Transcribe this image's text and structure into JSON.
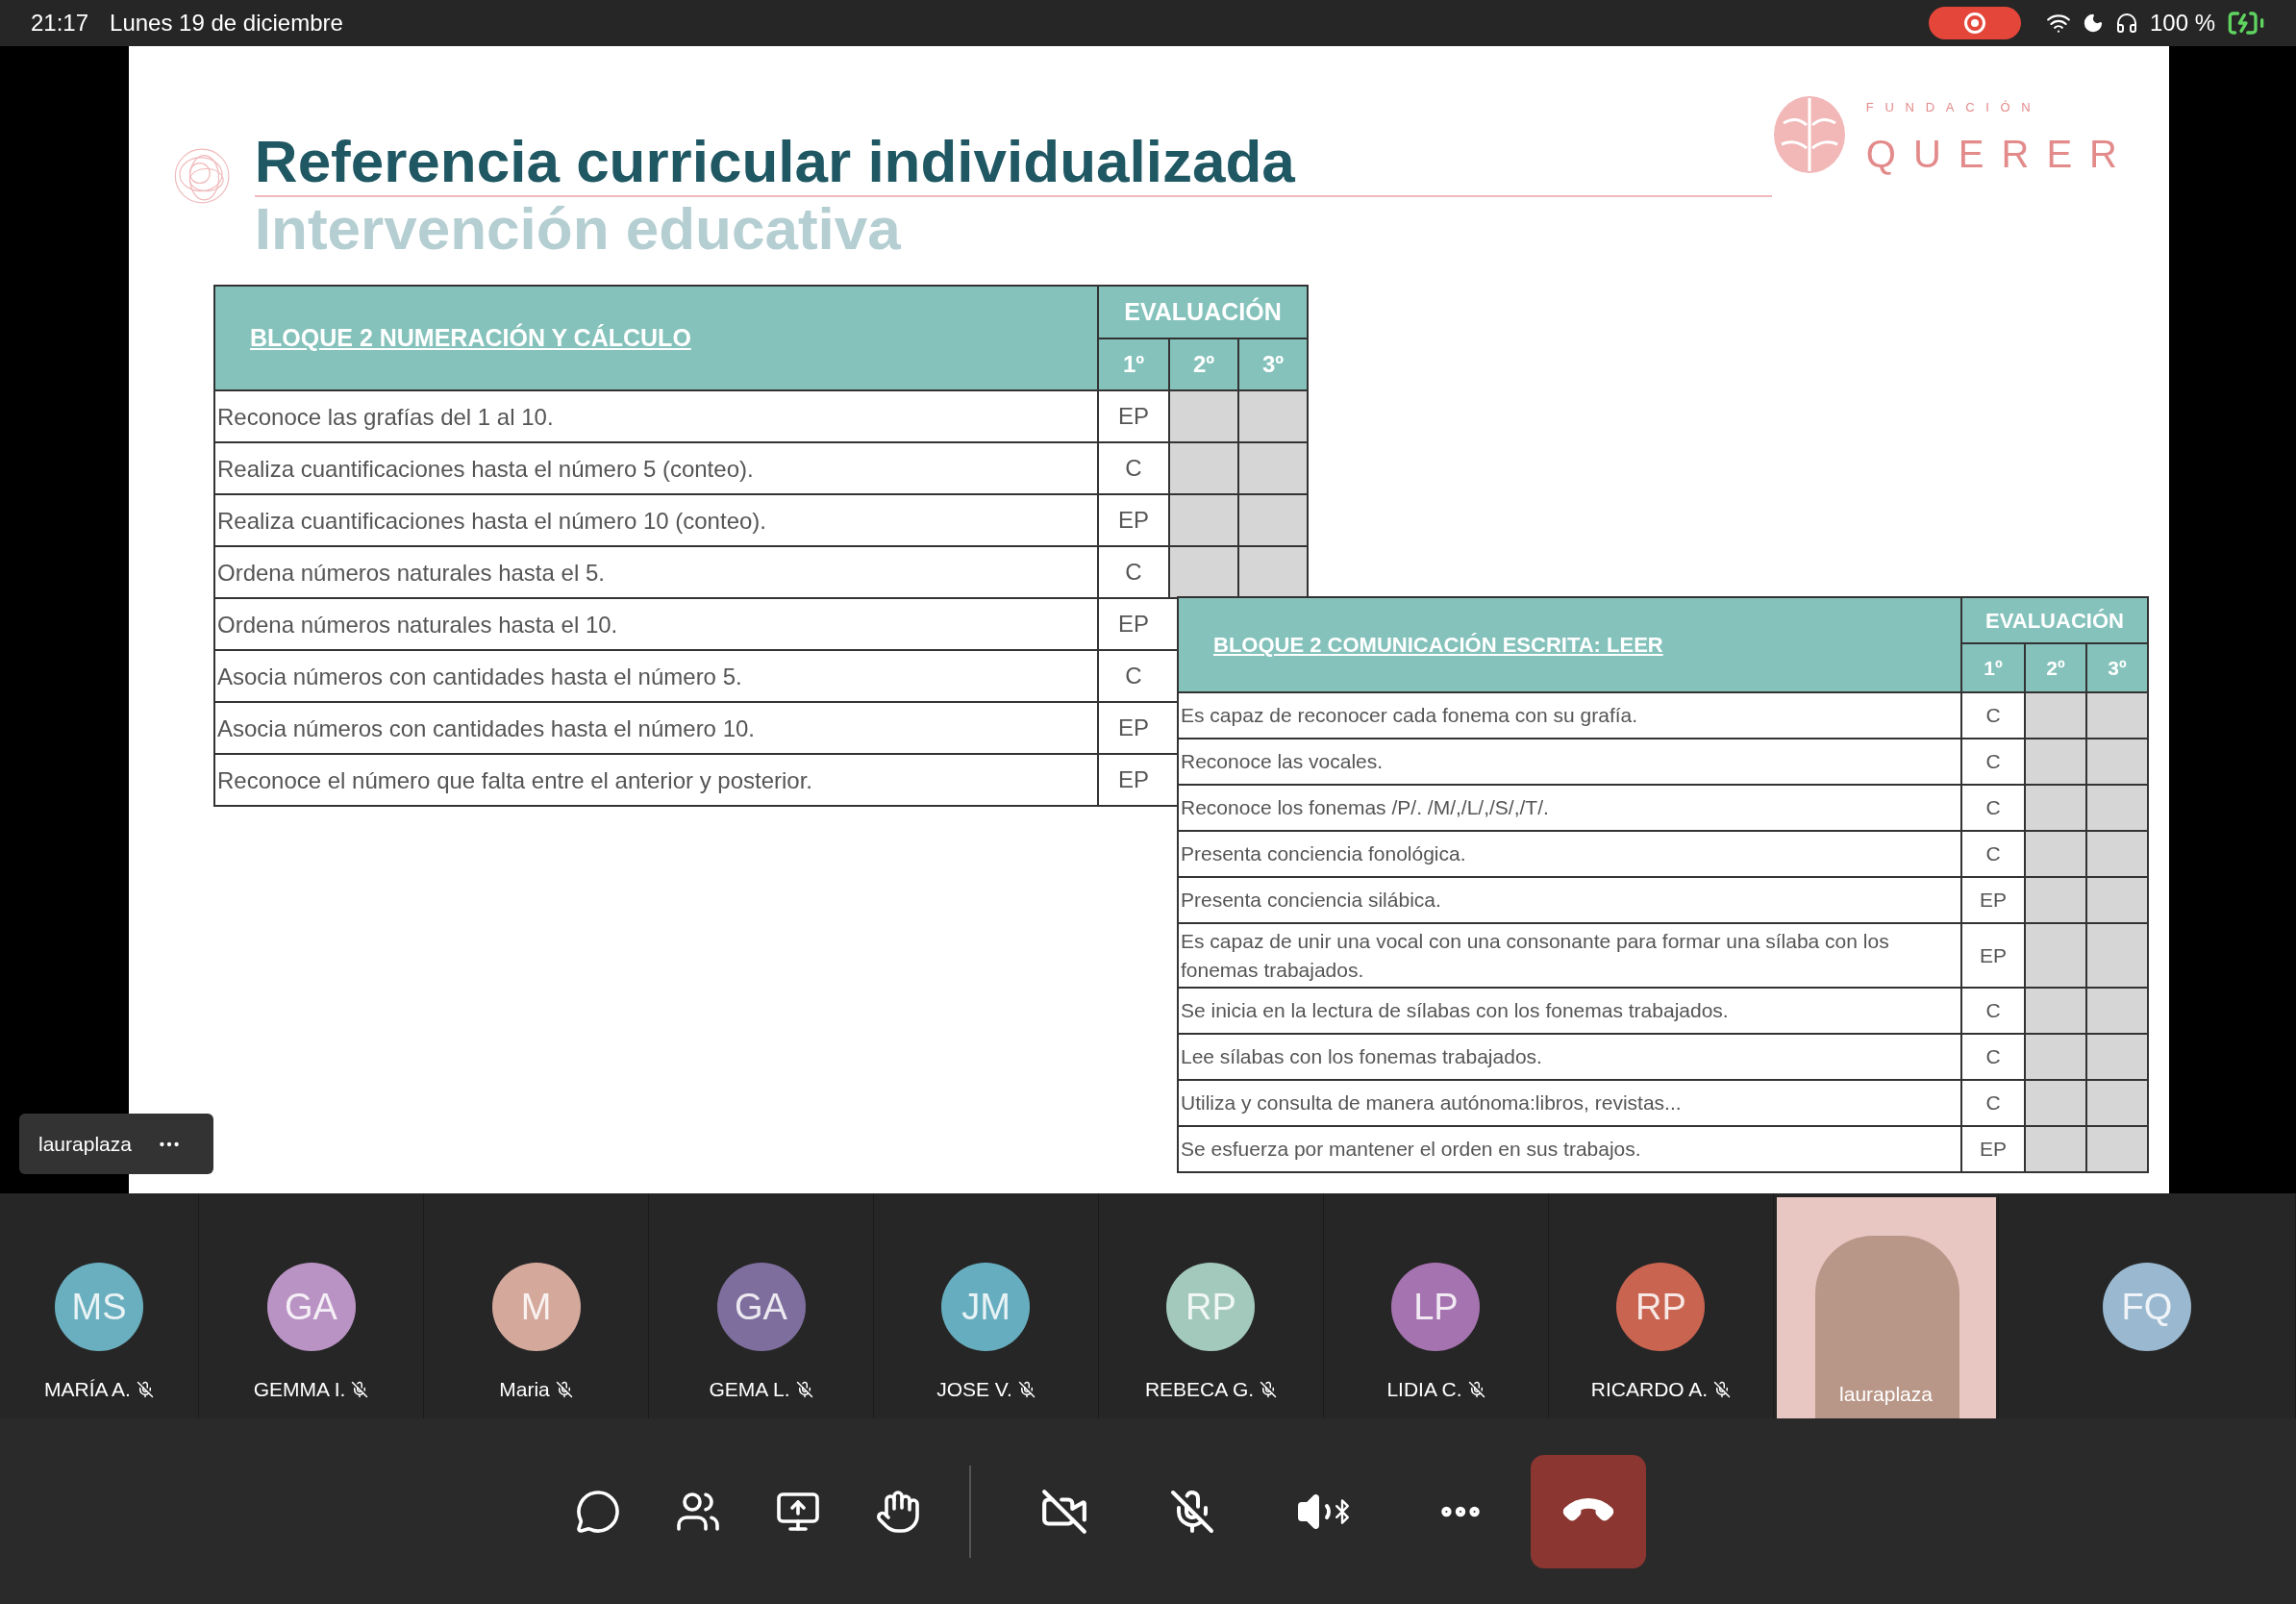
{
  "status_bar": {
    "time": "21:17",
    "date": "Lunes 19 de diciembre",
    "battery": "100 %"
  },
  "slide": {
    "title": "Referencia curricular individualizada",
    "subtitle": "Intervención educativa",
    "logo": {
      "top": "FUNDACIÓN",
      "name": "QUERER"
    },
    "tables": [
      {
        "title": "BLOQUE 2 NUMERACIÓN Y CÁLCULO",
        "eval_header": "EVALUACIÓN",
        "terms": [
          "1º",
          "2º",
          "3º"
        ],
        "rows": [
          {
            "text": "Reconoce las grafías del 1 al 10.",
            "grade": "EP"
          },
          {
            "text": "Realiza cuantificaciones hasta el número 5 (conteo).",
            "grade": "C"
          },
          {
            "text": "Realiza cuantificaciones hasta el número 10 (conteo).",
            "grade": "EP"
          },
          {
            "text": "Ordena números naturales hasta el 5.",
            "grade": "C"
          },
          {
            "text": "Ordena números naturales hasta el 10.",
            "grade": "EP"
          },
          {
            "text": "Asocia números con cantidades hasta el número 5.",
            "grade": "C"
          },
          {
            "text": "Asocia números con cantidades hasta el número 10.",
            "grade": "EP"
          },
          {
            "text": "Reconoce el número que falta entre el anterior y posterior.",
            "grade": "EP"
          }
        ]
      },
      {
        "title": "BLOQUE 2 COMUNICACIÓN ESCRITA: LEER",
        "eval_header": "EVALUACIÓN",
        "terms": [
          "1º",
          "2º",
          "3º"
        ],
        "rows": [
          {
            "text": "Es capaz de reconocer cada fonema con su grafía.",
            "grade": "C"
          },
          {
            "text": "Reconoce las vocales.",
            "grade": "C"
          },
          {
            "text": "Reconoce los fonemas /P/. /M/,/L/,/S/,/T/.",
            "grade": "C"
          },
          {
            "text": "Presenta conciencia fonológica.",
            "grade": "C"
          },
          {
            "text": "Presenta conciencia silábica.",
            "grade": "EP"
          },
          {
            "text": "Es capaz de unir una vocal con una consonante para formar una sílaba con los fonemas trabajados.",
            "grade": "EP"
          },
          {
            "text": "Se inicia en la lectura de sílabas con los fonemas trabajados.",
            "grade": "C"
          },
          {
            "text": "Lee sílabas con los fonemas trabajados.",
            "grade": "C"
          },
          {
            "text": "Utiliza y consulta de manera autónoma:libros, revistas...",
            "grade": "C"
          },
          {
            "text": "Se esfuerza por mantener el orden en sus trabajos.",
            "grade": "EP"
          }
        ]
      }
    ]
  },
  "presenter_label": {
    "name": "lauraplaza"
  },
  "participants": [
    {
      "kind": "avatar",
      "initials": "MS",
      "name": "MARÍA A.",
      "color": "#6aafbf",
      "muted": true
    },
    {
      "kind": "avatar",
      "initials": "GA",
      "name": "GEMMA I.",
      "color": "#b993c4",
      "muted": true
    },
    {
      "kind": "avatar",
      "initials": "M",
      "name": "Maria",
      "color": "#d4a99c",
      "muted": true
    },
    {
      "kind": "avatar",
      "initials": "GA",
      "name": "GEMA L.",
      "color": "#7e6e9e",
      "muted": true
    },
    {
      "kind": "avatar",
      "initials": "JM",
      "name": "JOSE V.",
      "color": "#66aebf",
      "muted": true
    },
    {
      "kind": "avatar",
      "initials": "RP",
      "name": "REBECA G.",
      "color": "#a3c9bd",
      "muted": true
    },
    {
      "kind": "avatar",
      "initials": "LP",
      "name": "LIDIA C.",
      "color": "#a573b0",
      "muted": true
    },
    {
      "kind": "avatar",
      "initials": "RP",
      "name": "RICARDO A.",
      "color": "#c96451",
      "muted": true
    },
    {
      "kind": "video",
      "name": "lauraplaza"
    },
    {
      "kind": "avatar",
      "initials": "FQ",
      "color": "#9ab8cf"
    }
  ],
  "toolbar": {
    "camera_on": false,
    "mic_on": false
  }
}
